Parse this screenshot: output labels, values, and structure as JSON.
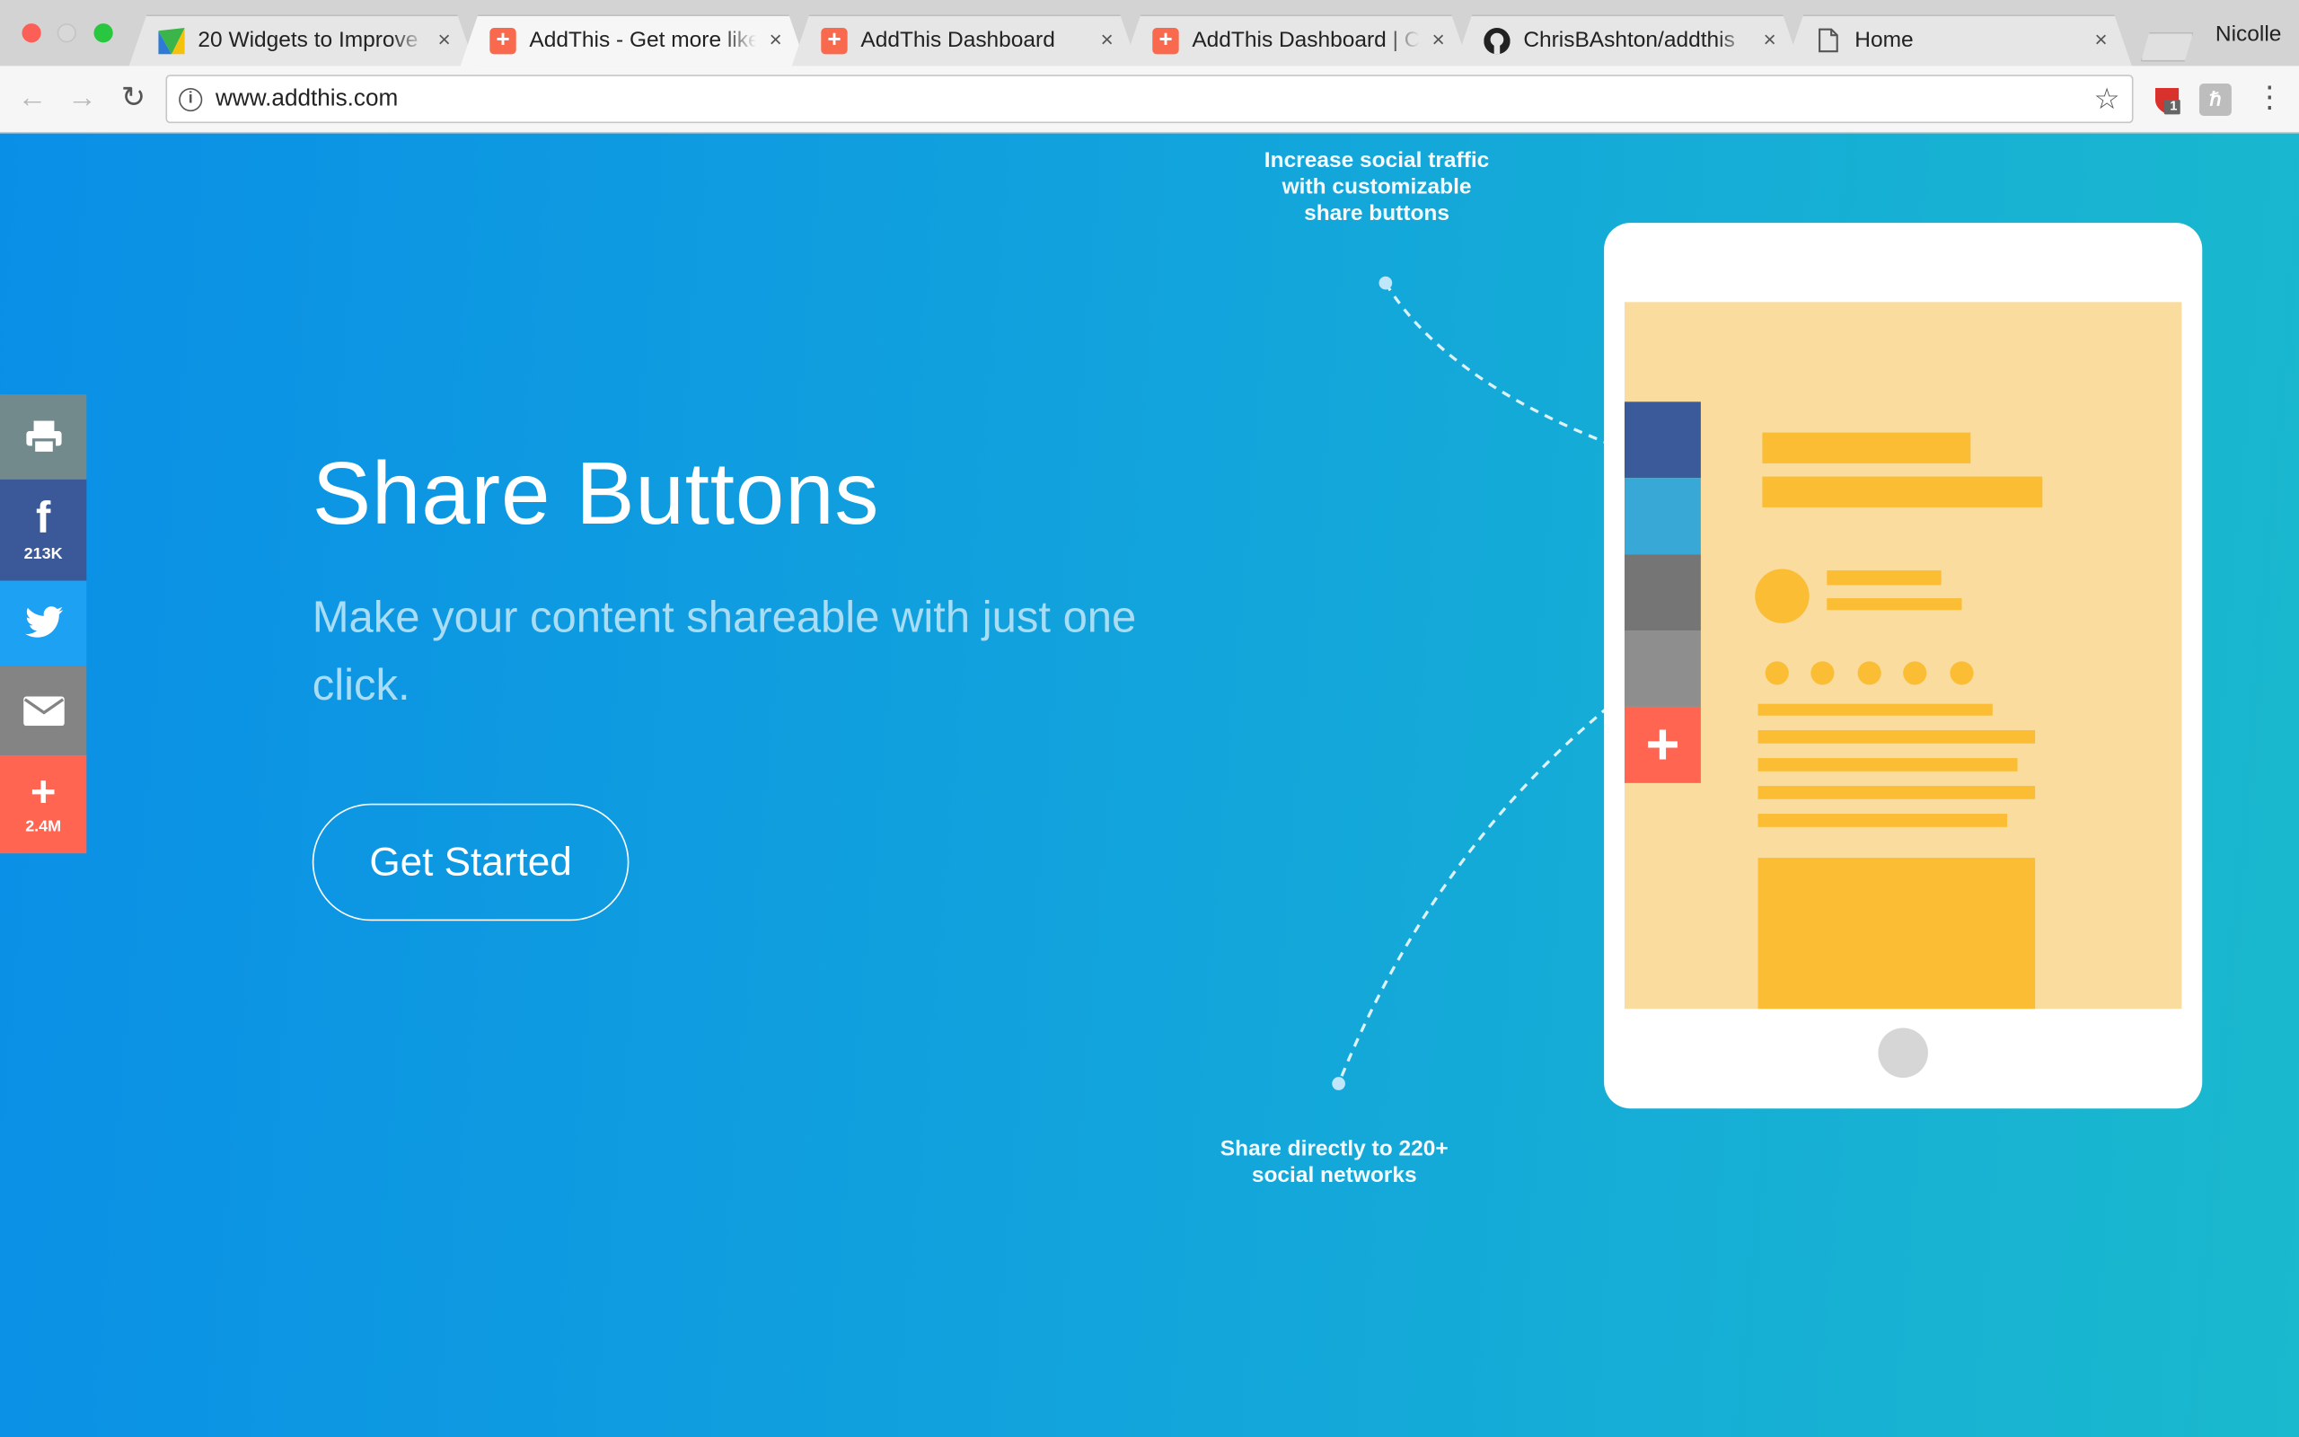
{
  "browser": {
    "tabs": [
      {
        "title": "20 Widgets to Improve",
        "favicon": "analytics-logo"
      },
      {
        "title": "AddThis - Get more likes",
        "favicon": "addthis-plus",
        "active": true
      },
      {
        "title": "AddThis Dashboard",
        "favicon": "addthis-plus"
      },
      {
        "title": "AddThis Dashboard | C",
        "favicon": "addthis-plus"
      },
      {
        "title": "ChrisBAshton/addthis",
        "favicon": "github-icon"
      },
      {
        "title": "Home",
        "favicon": "page-icon"
      }
    ],
    "close_glyph": "×",
    "profile_name": "Nicolle",
    "address": "www.addthis.com",
    "info_glyph": "i",
    "extension_badge": "1"
  },
  "share_bar": {
    "facebook_count": "213K",
    "more_count": "2.4M"
  },
  "hero": {
    "title": "Share Buttons",
    "subtitle": "Make your content shareable with just one click.",
    "cta_label": "Get Started"
  },
  "annotations": {
    "top": "Increase social traffic with customizable share buttons",
    "bottom": "Share directly to 220+ social networks"
  },
  "colors": {
    "page_gradient_start": "#0a8fe6",
    "page_gradient_end": "#1ab9ce",
    "facebook": "#3b5998",
    "twitter": "#1da1f2",
    "addthis_orange": "#ff6550",
    "tablet_screen": "#f9dc9e",
    "placeholder_yellow": "#fbbd33"
  }
}
